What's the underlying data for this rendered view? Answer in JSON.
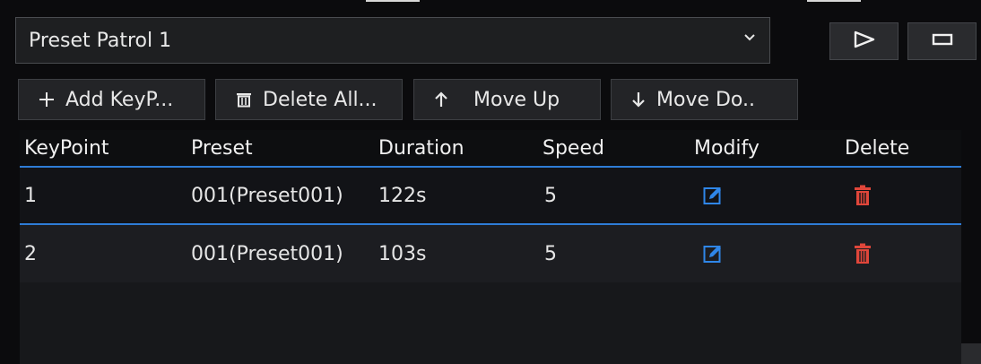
{
  "patrol_select": {
    "value": "Preset Patrol 1"
  },
  "controls": {
    "play_icon": "play-outline-icon",
    "stop_icon": "stop-rect-icon"
  },
  "toolbar": {
    "add_label": "Add KeyP...",
    "delete_all_label": "Delete All...",
    "move_up_label": "Move Up",
    "move_down_label": "Move Do.."
  },
  "table": {
    "headers": [
      "KeyPoint",
      "Preset",
      "Duration",
      "Speed",
      "Modify",
      "Delete"
    ],
    "rows": [
      {
        "keypoint": "1",
        "preset": "001(Preset001)",
        "duration": "122s",
        "speed": "5"
      },
      {
        "keypoint": "2",
        "preset": "001(Preset001)",
        "duration": "103s",
        "speed": "5"
      }
    ]
  },
  "colors": {
    "accent": "#2e7cd6",
    "delete": "#e0463a",
    "edit": "#2f86e8"
  }
}
